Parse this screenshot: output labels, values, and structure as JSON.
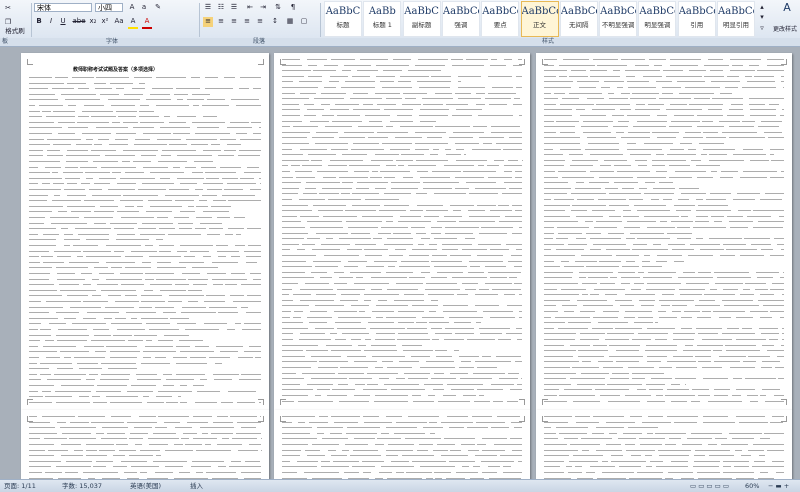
{
  "ribbon": {
    "format_painter": "格式刷",
    "font_name": "宋体",
    "font_size": "小四",
    "font_buttons": [
      "B",
      "I",
      "U",
      "abe",
      "x₂",
      "x²",
      "Aa",
      "A",
      "A"
    ],
    "para_buttons": [
      "≡",
      "≡",
      "≡",
      "≡",
      "≡",
      "↕",
      "¶"
    ],
    "groups": {
      "clipboard": "板",
      "font": "字体",
      "paragraph": "段落",
      "styles": "样式"
    },
    "styles": [
      {
        "sample": "AaBbC",
        "name": "标题",
        "selected": false
      },
      {
        "sample": "AaBb",
        "name": "标题 1",
        "selected": false
      },
      {
        "sample": "AaBbC",
        "name": "副标题",
        "selected": false
      },
      {
        "sample": "AaBbCcD",
        "name": "强调",
        "selected": false
      },
      {
        "sample": "AaBbCcD",
        "name": "要点",
        "selected": false
      },
      {
        "sample": "AaBbCcD",
        "name": "正文",
        "selected": true
      },
      {
        "sample": "AaBbCcD",
        "name": "无间隔",
        "selected": false
      },
      {
        "sample": "AaBbCcD",
        "name": "不明显强调",
        "selected": false
      },
      {
        "sample": "AaBbCcD",
        "name": "明显强调",
        "selected": false
      },
      {
        "sample": "AaBbCcD",
        "name": "引用",
        "selected": false
      },
      {
        "sample": "AaBbCcD",
        "name": "明显引用",
        "selected": false
      }
    ],
    "change_styles": "更改样式"
  },
  "document": {
    "title": "教师职称考试试题及答案（多项选择）"
  },
  "status": {
    "page_info": "页面: 1/11",
    "word_count": "字数: 15,037",
    "language": "英语(美国)",
    "insert_mode": "插入",
    "zoom": "60%"
  },
  "colors": {
    "ribbon_bg": "#dde6f1",
    "workspace_bg": "#a8b0ba",
    "selected_style": "#fff5d6"
  }
}
